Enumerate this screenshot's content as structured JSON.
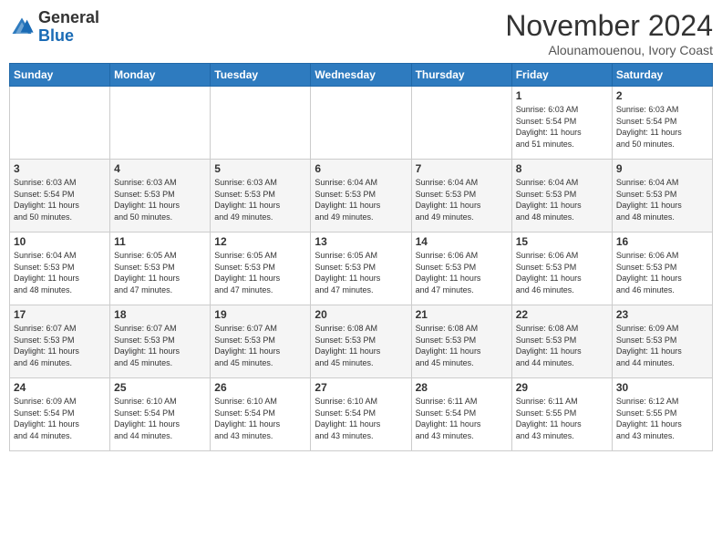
{
  "header": {
    "logo_general": "General",
    "logo_blue": "Blue",
    "month_title": "November 2024",
    "location": "Alounamouenou, Ivory Coast"
  },
  "weekdays": [
    "Sunday",
    "Monday",
    "Tuesday",
    "Wednesday",
    "Thursday",
    "Friday",
    "Saturday"
  ],
  "weeks": [
    [
      {
        "day": "",
        "info": ""
      },
      {
        "day": "",
        "info": ""
      },
      {
        "day": "",
        "info": ""
      },
      {
        "day": "",
        "info": ""
      },
      {
        "day": "",
        "info": ""
      },
      {
        "day": "1",
        "info": "Sunrise: 6:03 AM\nSunset: 5:54 PM\nDaylight: 11 hours\nand 51 minutes."
      },
      {
        "day": "2",
        "info": "Sunrise: 6:03 AM\nSunset: 5:54 PM\nDaylight: 11 hours\nand 50 minutes."
      }
    ],
    [
      {
        "day": "3",
        "info": "Sunrise: 6:03 AM\nSunset: 5:54 PM\nDaylight: 11 hours\nand 50 minutes."
      },
      {
        "day": "4",
        "info": "Sunrise: 6:03 AM\nSunset: 5:53 PM\nDaylight: 11 hours\nand 50 minutes."
      },
      {
        "day": "5",
        "info": "Sunrise: 6:03 AM\nSunset: 5:53 PM\nDaylight: 11 hours\nand 49 minutes."
      },
      {
        "day": "6",
        "info": "Sunrise: 6:04 AM\nSunset: 5:53 PM\nDaylight: 11 hours\nand 49 minutes."
      },
      {
        "day": "7",
        "info": "Sunrise: 6:04 AM\nSunset: 5:53 PM\nDaylight: 11 hours\nand 49 minutes."
      },
      {
        "day": "8",
        "info": "Sunrise: 6:04 AM\nSunset: 5:53 PM\nDaylight: 11 hours\nand 48 minutes."
      },
      {
        "day": "9",
        "info": "Sunrise: 6:04 AM\nSunset: 5:53 PM\nDaylight: 11 hours\nand 48 minutes."
      }
    ],
    [
      {
        "day": "10",
        "info": "Sunrise: 6:04 AM\nSunset: 5:53 PM\nDaylight: 11 hours\nand 48 minutes."
      },
      {
        "day": "11",
        "info": "Sunrise: 6:05 AM\nSunset: 5:53 PM\nDaylight: 11 hours\nand 47 minutes."
      },
      {
        "day": "12",
        "info": "Sunrise: 6:05 AM\nSunset: 5:53 PM\nDaylight: 11 hours\nand 47 minutes."
      },
      {
        "day": "13",
        "info": "Sunrise: 6:05 AM\nSunset: 5:53 PM\nDaylight: 11 hours\nand 47 minutes."
      },
      {
        "day": "14",
        "info": "Sunrise: 6:06 AM\nSunset: 5:53 PM\nDaylight: 11 hours\nand 47 minutes."
      },
      {
        "day": "15",
        "info": "Sunrise: 6:06 AM\nSunset: 5:53 PM\nDaylight: 11 hours\nand 46 minutes."
      },
      {
        "day": "16",
        "info": "Sunrise: 6:06 AM\nSunset: 5:53 PM\nDaylight: 11 hours\nand 46 minutes."
      }
    ],
    [
      {
        "day": "17",
        "info": "Sunrise: 6:07 AM\nSunset: 5:53 PM\nDaylight: 11 hours\nand 46 minutes."
      },
      {
        "day": "18",
        "info": "Sunrise: 6:07 AM\nSunset: 5:53 PM\nDaylight: 11 hours\nand 45 minutes."
      },
      {
        "day": "19",
        "info": "Sunrise: 6:07 AM\nSunset: 5:53 PM\nDaylight: 11 hours\nand 45 minutes."
      },
      {
        "day": "20",
        "info": "Sunrise: 6:08 AM\nSunset: 5:53 PM\nDaylight: 11 hours\nand 45 minutes."
      },
      {
        "day": "21",
        "info": "Sunrise: 6:08 AM\nSunset: 5:53 PM\nDaylight: 11 hours\nand 45 minutes."
      },
      {
        "day": "22",
        "info": "Sunrise: 6:08 AM\nSunset: 5:53 PM\nDaylight: 11 hours\nand 44 minutes."
      },
      {
        "day": "23",
        "info": "Sunrise: 6:09 AM\nSunset: 5:53 PM\nDaylight: 11 hours\nand 44 minutes."
      }
    ],
    [
      {
        "day": "24",
        "info": "Sunrise: 6:09 AM\nSunset: 5:54 PM\nDaylight: 11 hours\nand 44 minutes."
      },
      {
        "day": "25",
        "info": "Sunrise: 6:10 AM\nSunset: 5:54 PM\nDaylight: 11 hours\nand 44 minutes."
      },
      {
        "day": "26",
        "info": "Sunrise: 6:10 AM\nSunset: 5:54 PM\nDaylight: 11 hours\nand 43 minutes."
      },
      {
        "day": "27",
        "info": "Sunrise: 6:10 AM\nSunset: 5:54 PM\nDaylight: 11 hours\nand 43 minutes."
      },
      {
        "day": "28",
        "info": "Sunrise: 6:11 AM\nSunset: 5:54 PM\nDaylight: 11 hours\nand 43 minutes."
      },
      {
        "day": "29",
        "info": "Sunrise: 6:11 AM\nSunset: 5:55 PM\nDaylight: 11 hours\nand 43 minutes."
      },
      {
        "day": "30",
        "info": "Sunrise: 6:12 AM\nSunset: 5:55 PM\nDaylight: 11 hours\nand 43 minutes."
      }
    ]
  ]
}
